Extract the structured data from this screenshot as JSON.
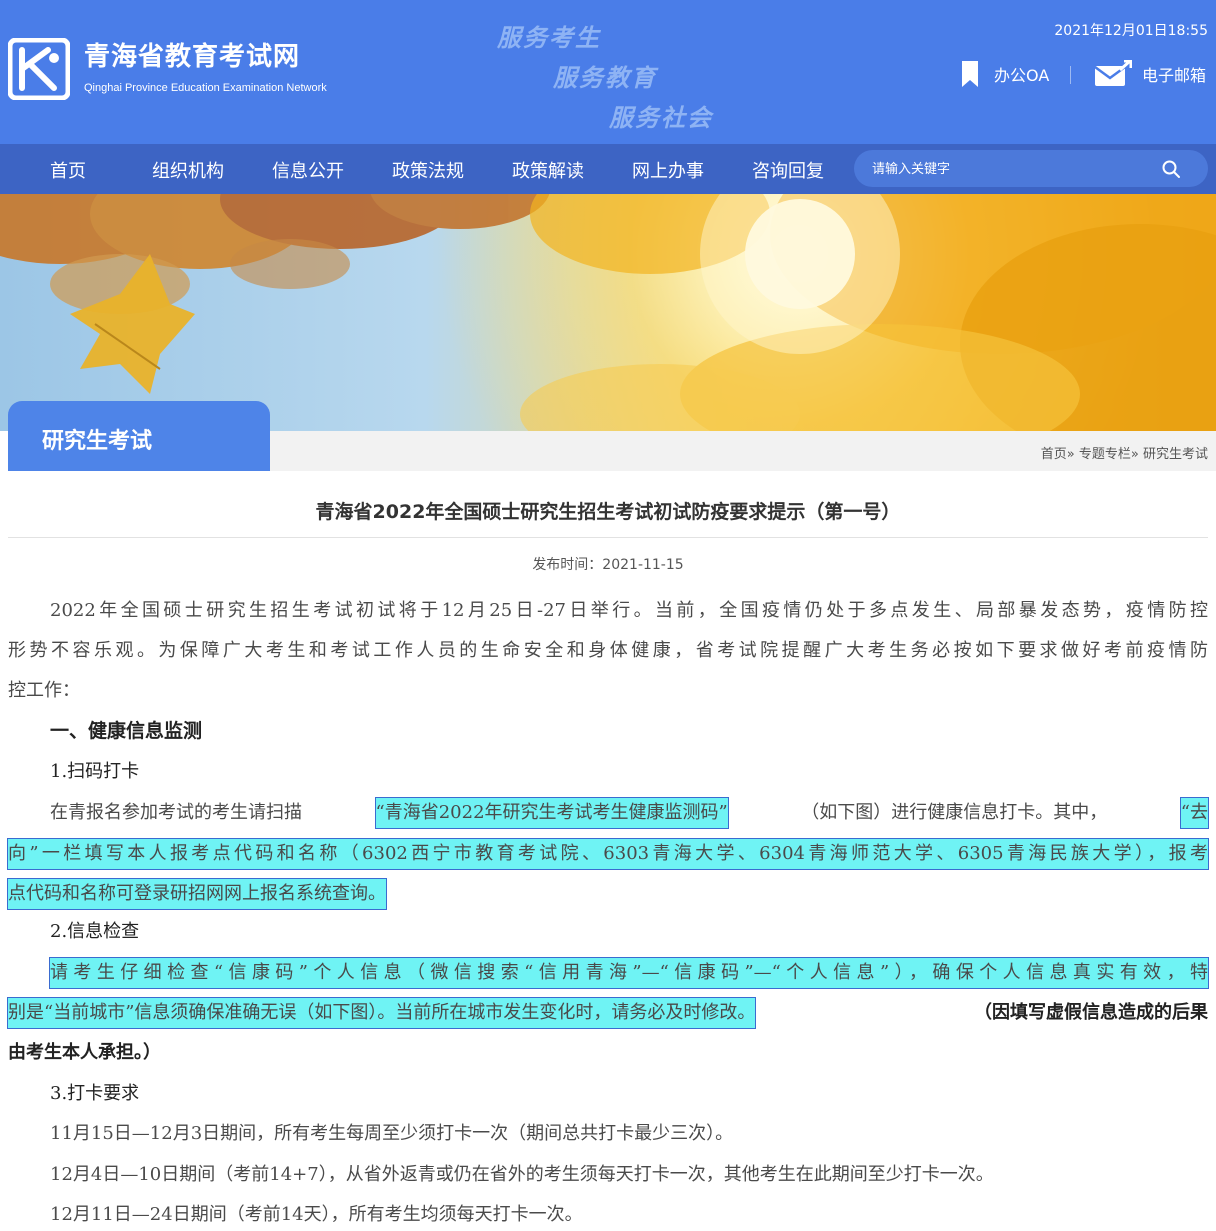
{
  "header": {
    "site_title": "青海省教育考试网",
    "site_subtitle": "Qinghai Province Education Examination Network",
    "slogans": [
      "服务考生",
      "服务教育",
      "服务社会"
    ],
    "datetime": "2021年12月01日18:55",
    "links": {
      "oa": "办公OA",
      "mail": "电子邮箱"
    },
    "colors": {
      "header_bg": "#4a7de8",
      "nav_bg": "#3d64c4"
    }
  },
  "nav": {
    "items": [
      "首页",
      "组织机构",
      "信息公开",
      "政策法规",
      "政策解读",
      "网上办事",
      "咨询回复"
    ],
    "search_placeholder": "请输入关键字"
  },
  "section": {
    "title": "研究生考试",
    "breadcrumb": [
      "首页",
      "专题专栏",
      "研究生考试"
    ],
    "breadcrumb_sep": "»"
  },
  "article": {
    "title": "青海省2022年全国硕士研究生招生考试初试防疫要求提示（第一号）",
    "pubdate": "发布时间：2021-11-15",
    "intro": [
      "2022年全国硕士研究生招生考试初试将于12月25日-27日举行。当前，全国疫情仍处于多点发生、局部暴发态势，疫情防控",
      "形势不容乐观。为保障广大考生和考试工作人员的生命安全和身体健康，省考试院提醒广大考生务必按如下要求做好考前疫情防",
      "控工作："
    ],
    "h1": "一、健康信息监测",
    "s1": {
      "title": "1.扫码打卡",
      "l1_pre": "在青报名参加考试的考生请扫描",
      "l1_hl1": "“青海省2022年研究生考试考生健康监测码”",
      "l1_mid": "（如下图）进行健康信息打卡。其中，",
      "l1_hl2": "“去",
      "l2": "向”一栏填写本人报考点代码和名称（6302西宁市教育考试院、6303青海大学、6304青海师范大学、6305青海民族大学），报考",
      "l3": "点代码和名称可登录研招网网上报名系统查询。"
    },
    "s2": {
      "title": "2.信息检查",
      "l1": "请考生仔细检查“信康码”个人信息（微信搜索“信用青海”—“信康码”—“个人信息”），确保个人信息真实有效，特",
      "l2_hl": "别是“当前城市”信息须确保准确无误（如下图）。当前所在城市发生变化时，请务必及时修改。",
      "l2_bold": "（因填写虚假信息造成的后果",
      "l3_bold": "由考生本人承担。）"
    },
    "s3": {
      "title": "3.打卡要求",
      "l1": "11月15日—12月3日期间，所有考生每周至少须打卡一次（期间总共打卡最少三次）。",
      "l2": "12月4日—10日期间（考前14+7），从省外返青或仍在省外的考生须每天打卡一次，其他考生在此期间至少打卡一次。",
      "l3": "12月11日—24日期间（考前14天），所有考生均须每天打卡一次。"
    },
    "highlight_color": "#6ff3f4"
  }
}
